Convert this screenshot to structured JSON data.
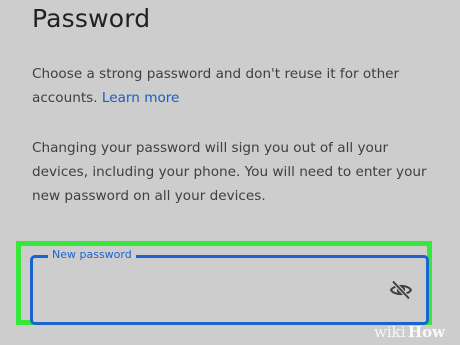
{
  "page": {
    "title": "Password",
    "intro_text": "Choose a strong password and don't reuse it for other accounts. ",
    "learn_more_link": "Learn more",
    "warning_text": "Changing your password will sign you out of all your devices, including your phone. You will need to enter your new password on all your devices."
  },
  "password_field": {
    "label": "New password",
    "value": "",
    "visibility_icon": "eye-off-icon"
  },
  "watermark": {
    "text": "wikiHow"
  },
  "colors": {
    "background": "#cdcdcd",
    "link": "#1a5dc4",
    "field_border": "#1b63d1",
    "highlight": "#36e83a"
  }
}
